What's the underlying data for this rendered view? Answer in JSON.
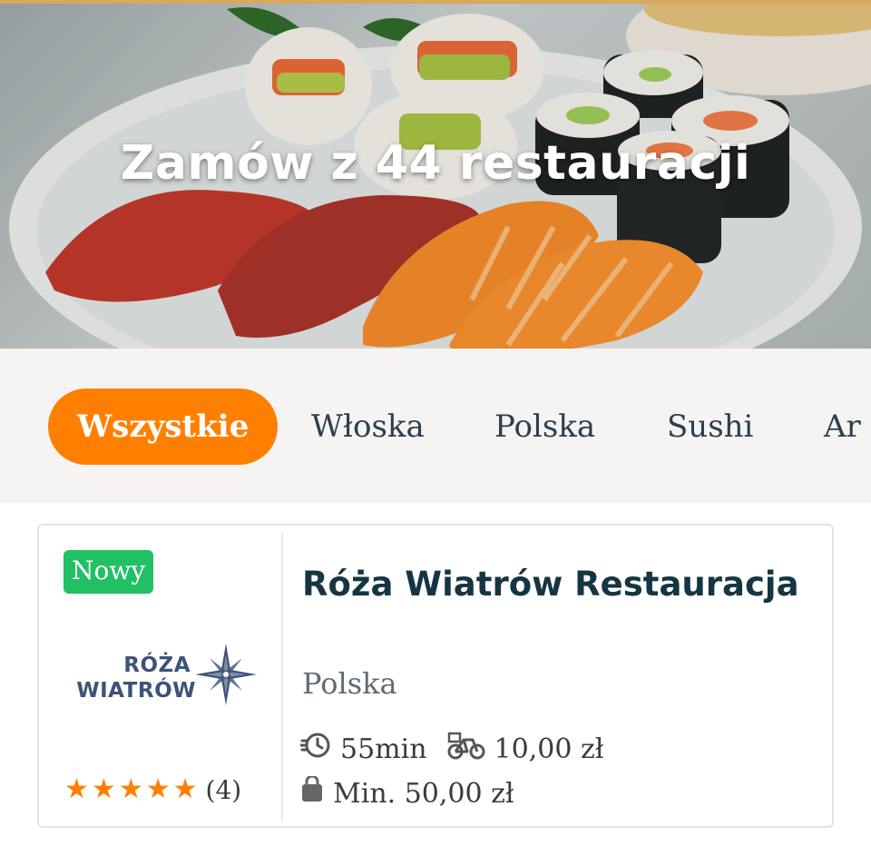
{
  "hero": {
    "title": "Zamów z 44 restauracji"
  },
  "filters": {
    "items": [
      {
        "label": "Wszystkie",
        "active": true
      },
      {
        "label": "Włoska",
        "active": false
      },
      {
        "label": "Polska",
        "active": false
      },
      {
        "label": "Sushi",
        "active": false
      },
      {
        "label": "Ar",
        "active": false
      }
    ]
  },
  "restaurant": {
    "badge": "Nowy",
    "logo_line1": "RÓŻA",
    "logo_line2": "WIATRÓW",
    "name": "Róża Wiatrów Restauracja",
    "cuisine": "Polska",
    "delivery_time": "55min",
    "delivery_fee": "10,00 zł",
    "min_order": "Min. 50,00 zł",
    "rating_stars": 5,
    "rating_count": "(4)"
  },
  "icons": {
    "clock": "clock-fast-icon",
    "bike": "delivery-bike-icon",
    "bag": "shopping-bag-icon",
    "star": "star-icon"
  },
  "colors": {
    "accent": "#ff8000",
    "badge_green": "#21c064",
    "title_dark": "#163543",
    "logo_blue": "#3d5377"
  }
}
